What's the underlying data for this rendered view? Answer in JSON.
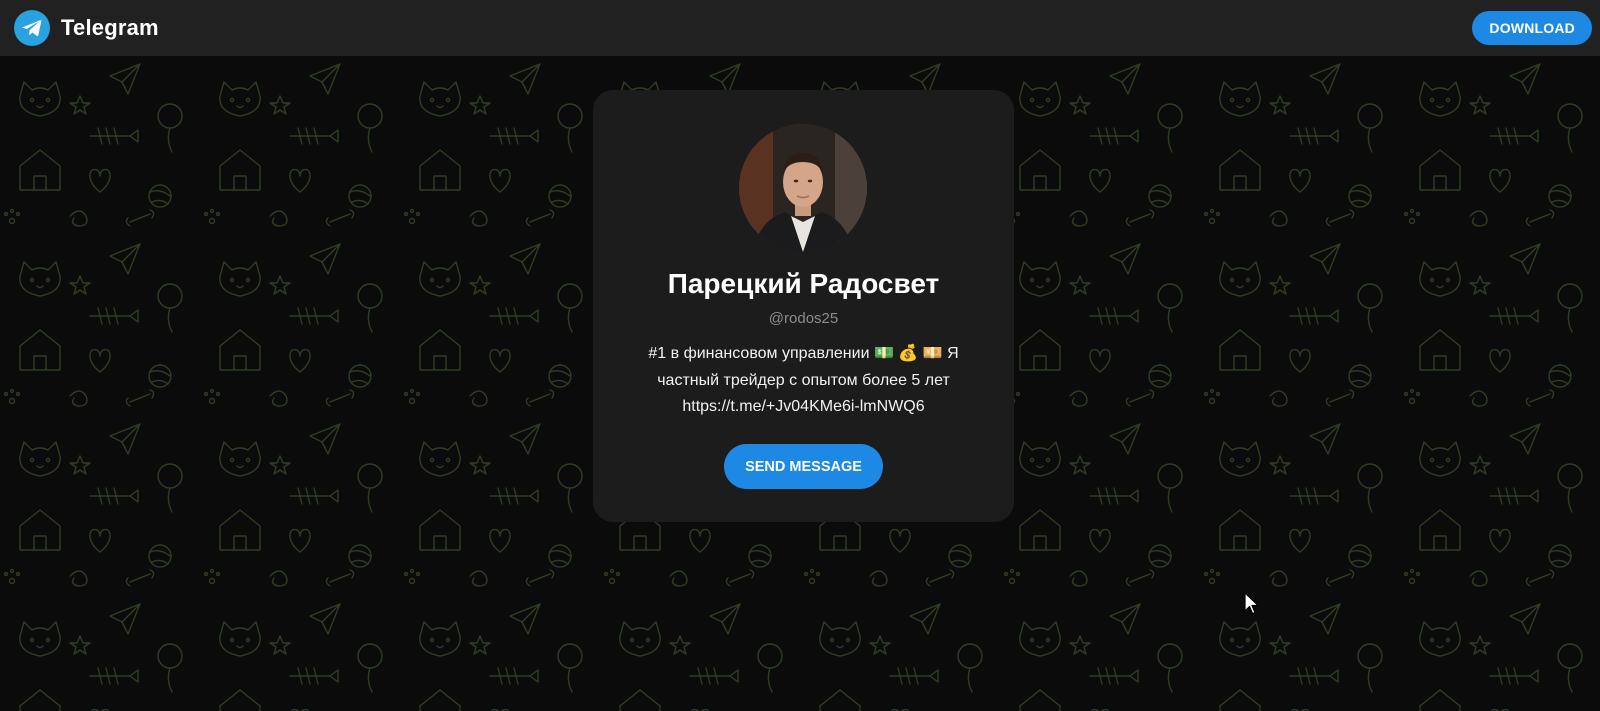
{
  "header": {
    "app_name": "Telegram",
    "logo_icon": "telegram-paper-plane-icon",
    "download_label": "DOWNLOAD"
  },
  "profile": {
    "name": "Парецкий Радосвет",
    "username": "@rodos25",
    "bio_line1": "#1 в финансовом управлении 💵 💰 💴 Я",
    "bio_line2": "частный трейдер с опытом более 5 лет",
    "bio_line3": "https://t.me/+Jv04KMe6i-lmNWQ6",
    "send_message_label": "SEND MESSAGE"
  },
  "colors": {
    "accent": "#1e88e5",
    "header_bg": "#212121",
    "card_bg": "#1c1c1d",
    "pattern": "#2b3a22"
  }
}
